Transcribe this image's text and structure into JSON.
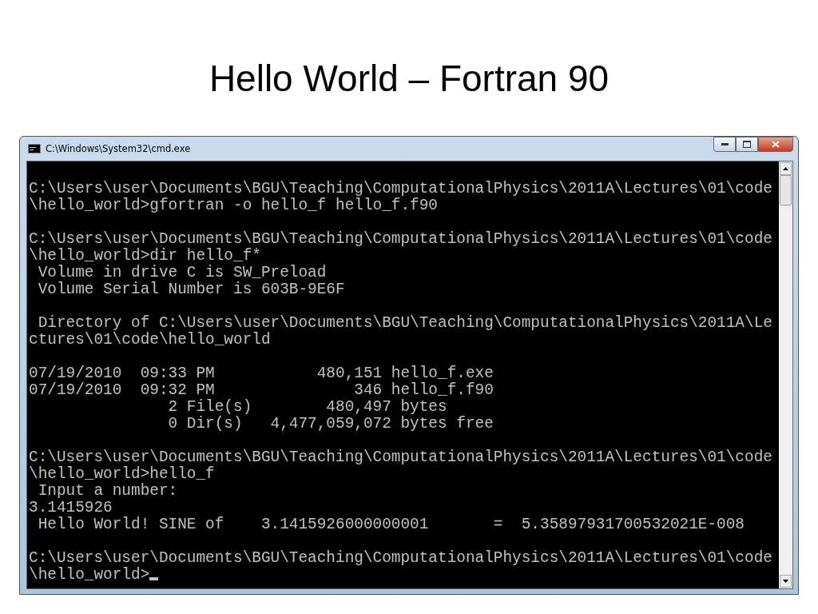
{
  "slide": {
    "title": "Hello World – Fortran 90"
  },
  "window": {
    "title": "C:\\Windows\\System32\\cmd.exe",
    "cursor": true
  },
  "console": [
    [
      "C:\\Users\\user\\Documents\\BGU\\Teaching\\ComputationalPhysics\\2011A\\Lectures\\01\\code",
      "\\hello_world>gfortran -o hello_f hello_f.f90"
    ],
    [
      "C:\\Users\\user\\Documents\\BGU\\Teaching\\ComputationalPhysics\\2011A\\Lectures\\01\\code",
      "\\hello_world>dir hello_f*",
      " Volume in drive C is SW_Preload",
      " Volume Serial Number is 603B-9E6F"
    ],
    [
      " Directory of C:\\Users\\user\\Documents\\BGU\\Teaching\\ComputationalPhysics\\2011A\\Le",
      "ctures\\01\\code\\hello_world"
    ],
    [
      "07/19/2010  09:33 PM           480,151 hello_f.exe",
      "07/19/2010  09:32 PM               346 hello_f.f90",
      "               2 File(s)        480,497 bytes",
      "               0 Dir(s)   4,477,059,072 bytes free"
    ],
    [
      "C:\\Users\\user\\Documents\\BGU\\Teaching\\ComputationalPhysics\\2011A\\Lectures\\01\\code",
      "\\hello_world>hello_f",
      " Input a number:",
      "3.1415926",
      " Hello World! SINE of    3.1415926000000001       =  5.35897931700532021E-008"
    ],
    [
      "C:\\Users\\user\\Documents\\BGU\\Teaching\\ComputationalPhysics\\2011A\\Lectures\\01\\code",
      "\\hello_world>"
    ]
  ]
}
